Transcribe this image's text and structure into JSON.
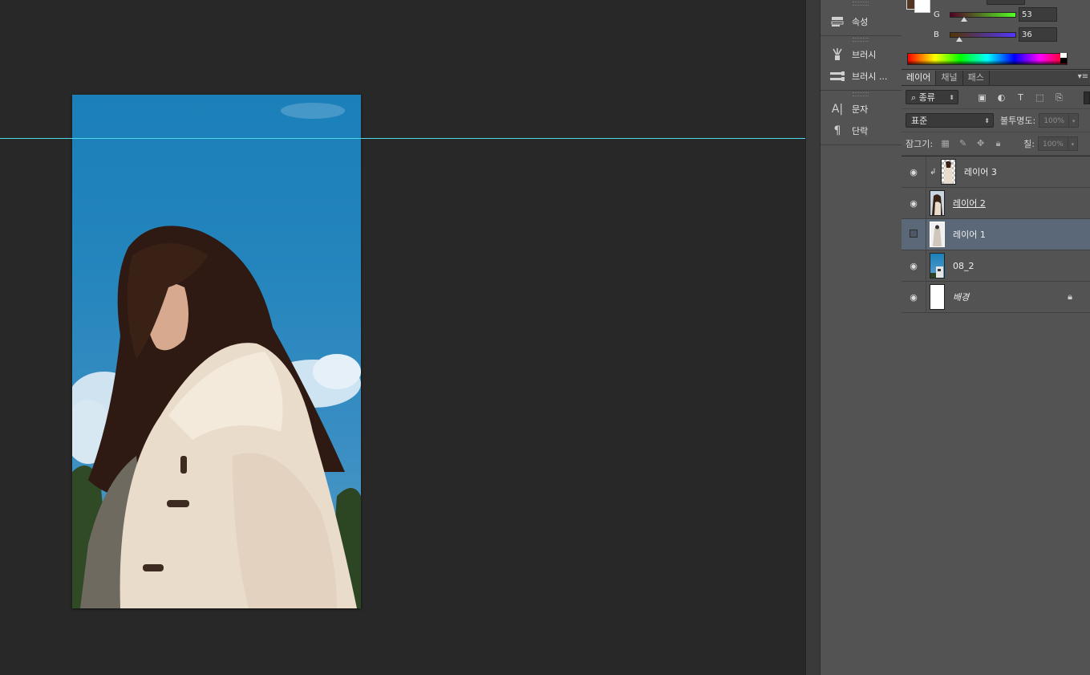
{
  "dock": {
    "groups": [
      {
        "items": [
          {
            "label": "속성",
            "icon": "properties-icon"
          }
        ]
      },
      {
        "items": [
          {
            "label": "브러시",
            "icon": "brush-icon"
          },
          {
            "label": "브러시 ...",
            "icon": "brush-presets-icon"
          }
        ]
      },
      {
        "items": [
          {
            "label": "문자",
            "icon": "character-icon"
          },
          {
            "label": "단락",
            "icon": "paragraph-icon"
          }
        ]
      }
    ]
  },
  "color": {
    "g_label": "G",
    "g_value": "53",
    "b_label": "B",
    "b_value": "36",
    "foreground": "#533524",
    "background": "#ffffff"
  },
  "layers_panel": {
    "tabs": [
      "레이어",
      "채널",
      "패스"
    ],
    "filter_select": "종류",
    "blend_mode": "표준",
    "opacity_label": "불투명도:",
    "opacity_value": "100%",
    "lock_label": "잠그기:",
    "fill_label": "칠:",
    "fill_value": "100%",
    "layers": [
      {
        "name": "레이어 3",
        "visible": true,
        "clipped": true,
        "selected": false
      },
      {
        "name": "레이어 2",
        "visible": true,
        "clipped": false,
        "selected": false
      },
      {
        "name": "레이어 1",
        "visible": false,
        "clipped": false,
        "selected": true
      },
      {
        "name": "08_2",
        "visible": true,
        "clipped": false,
        "selected": false
      },
      {
        "name": "배경",
        "visible": true,
        "clipped": false,
        "selected": false,
        "locked": true
      }
    ]
  }
}
